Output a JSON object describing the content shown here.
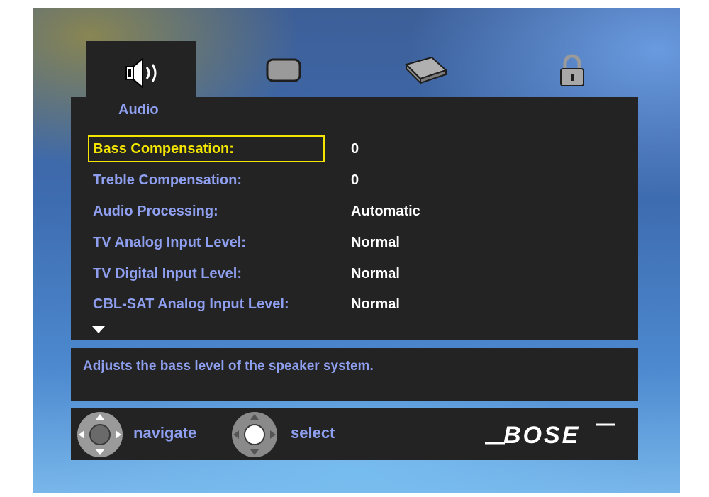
{
  "tabs": [
    {
      "icon": "speaker-icon",
      "active": true
    },
    {
      "icon": "tv-screen-icon",
      "active": false
    },
    {
      "icon": "media-device-icon",
      "active": false
    },
    {
      "icon": "lock-icon",
      "active": false
    }
  ],
  "menu": {
    "title": "Audio",
    "rows": [
      {
        "label": "Bass Compensation:",
        "value": "0",
        "selected": true
      },
      {
        "label": "Treble Compensation:",
        "value": "0"
      },
      {
        "label": "Audio Processing:",
        "value": "Automatic"
      },
      {
        "label": "TV Analog Input Level:",
        "value": "Normal"
      },
      {
        "label": "TV Digital Input Level:",
        "value": "Normal"
      },
      {
        "label": "CBL-SAT Analog Input Level:",
        "value": "Normal"
      }
    ],
    "more_indicator": "scroll-down-arrow-icon"
  },
  "description": "Adjusts the bass level of the speaker system.",
  "footer": {
    "navigate_label": "navigate",
    "select_label": "select",
    "brand": "BOSE"
  },
  "colors": {
    "panel": "#232323",
    "label": "#8f9ff0",
    "value": "#ffffff",
    "highlight": "#f3e500"
  }
}
